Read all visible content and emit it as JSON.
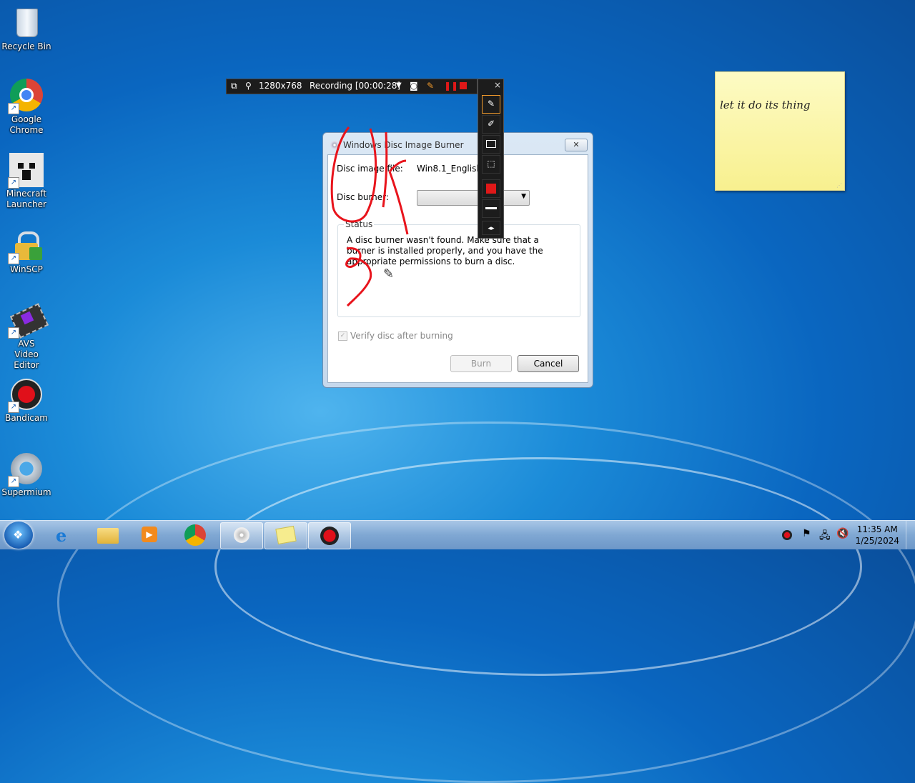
{
  "desktop": {
    "icons": [
      {
        "label": "Recycle Bin",
        "icon": "recycle-bin-icon"
      },
      {
        "label": "Google Chrome",
        "icon": "chrome-icon"
      },
      {
        "label": "Minecraft Launcher",
        "icon": "minecraft-icon"
      },
      {
        "label": "WinSCP",
        "icon": "winscp-icon"
      },
      {
        "label": "AVS Video Editor",
        "icon": "film-icon"
      },
      {
        "label": "Bandicam",
        "icon": "bandicam-icon"
      },
      {
        "label": "Supermium",
        "icon": "supermium-icon"
      }
    ]
  },
  "recorder": {
    "resolution": "1280x768",
    "status": "Recording [00:00:28]",
    "close_glyph": "×"
  },
  "sticky_note": {
    "text": "let it do its thing"
  },
  "dialog": {
    "title": "Windows Disc Image Burner",
    "disc_image_label": "Disc image file:",
    "disc_image_value": "Win8.1_English_x",
    "disc_burner_label": "Disc burner:",
    "disc_burner_value": "",
    "status_legend": "Status",
    "status_message": "A disc burner wasn't found. Make sure that a burner is installed properly, and you have the appropriate permissions to burn a disc.",
    "verify_label": "Verify disc after burning",
    "verify_checked": true,
    "burn_label": "Burn",
    "cancel_label": "Cancel"
  },
  "taskbar": {
    "clock_time": "11:35 AM",
    "clock_date": "1/25/2024"
  },
  "colors": {
    "annotation": "#e8141c",
    "recorder_bg": "#1c1c1c"
  }
}
